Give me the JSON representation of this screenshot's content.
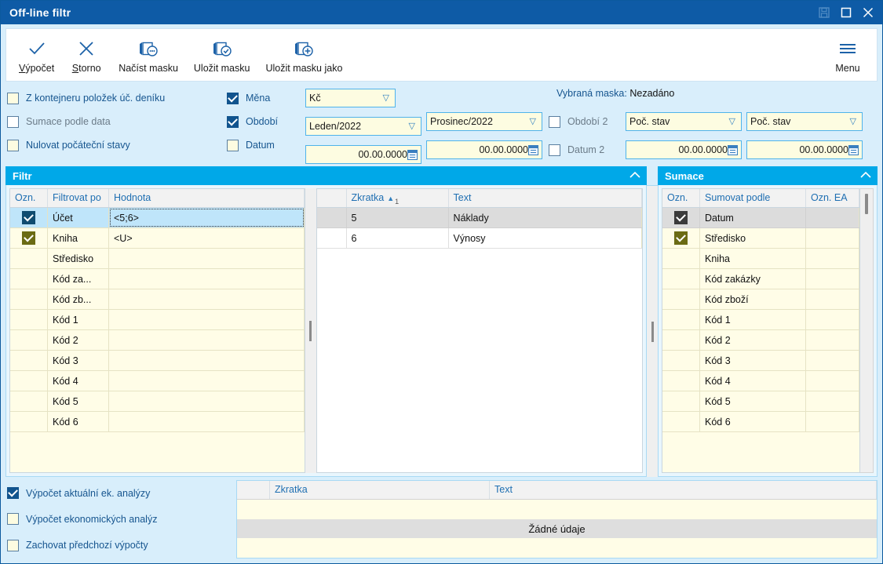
{
  "window": {
    "title": "Off-line filtr",
    "controls": [
      {
        "name": "save-icon",
        "glyph": "save"
      },
      {
        "name": "maximize-icon",
        "glyph": "maximize"
      },
      {
        "name": "close-icon",
        "glyph": "close"
      }
    ]
  },
  "toolbar": {
    "items": [
      {
        "name": "vypocet",
        "label": "Výpočet",
        "accel": "V",
        "icon": "check-icon"
      },
      {
        "name": "storno",
        "label": "Storno",
        "accel": "S",
        "icon": "close-icon"
      },
      {
        "name": "nacist-masku",
        "label": "Načíst masku",
        "icon": "mask-load-icon"
      },
      {
        "name": "ulozit-masku",
        "label": "Uložit masku",
        "icon": "mask-save-icon"
      },
      {
        "name": "ulozit-masku-jako",
        "label": "Uložit masku jako",
        "icon": "mask-saveas-icon"
      }
    ],
    "menu_label": "Menu"
  },
  "options": {
    "left_checks": [
      {
        "label": "Z kontejneru položek úč. deníku",
        "checked": false,
        "style": "cream"
      },
      {
        "label": "Sumace podle data",
        "checked": false,
        "style": "white",
        "dimmed": true
      },
      {
        "label": "Nulovat počáteční stavy",
        "checked": false,
        "style": "cream"
      }
    ],
    "mid_checks": [
      {
        "label": "Měna",
        "checked": true
      },
      {
        "label": "Období",
        "checked": true
      },
      {
        "label": "Datum",
        "checked": false
      }
    ],
    "second_checks": [
      {
        "label": "Období 2",
        "checked": false
      },
      {
        "label": "Datum 2",
        "checked": false
      }
    ],
    "fields": {
      "mena": "Kč",
      "obdobi_from": "Leden/2022",
      "obdobi_to": "Prosinec/2022",
      "datum_from": "00.00.0000",
      "datum_to": "00.00.0000",
      "obdobi2_from": "Poč. stav",
      "obdobi2_to": "Poč. stav",
      "datum2_from": "00.00.0000",
      "datum2_to": "00.00.0000"
    },
    "mask_label": "Vybraná maska:",
    "mask_value": "Nezadáno"
  },
  "filter_panel": {
    "title": "Filtr",
    "collapse_icon": "chevron-up-icon",
    "columns": [
      "Ozn.",
      "Filtrovat po",
      "Hodnota"
    ],
    "rows": [
      {
        "checked": true,
        "check_style": "navy",
        "name": "Účet",
        "value": "<5;6>",
        "selected": true
      },
      {
        "checked": true,
        "check_style": "olive",
        "name": "Kniha",
        "value": "<U>",
        "selected": false
      },
      {
        "checked": false,
        "name": "Středisko",
        "value": "",
        "selected": false
      },
      {
        "checked": false,
        "name": "Kód za...",
        "value": "",
        "selected": false
      },
      {
        "checked": false,
        "name": "Kód zb...",
        "value": "",
        "selected": false
      },
      {
        "checked": false,
        "name": "Kód 1",
        "value": "",
        "selected": false
      },
      {
        "checked": false,
        "name": "Kód 2",
        "value": "",
        "selected": false
      },
      {
        "checked": false,
        "name": "Kód 3",
        "value": "",
        "selected": false
      },
      {
        "checked": false,
        "name": "Kód 4",
        "value": "",
        "selected": false
      },
      {
        "checked": false,
        "name": "Kód 5",
        "value": "",
        "selected": false
      },
      {
        "checked": false,
        "name": "Kód 6",
        "value": "",
        "selected": false
      }
    ]
  },
  "detail_panel": {
    "columns": [
      {
        "label": "Zkratka",
        "sort": "asc",
        "sort_order": "1"
      },
      {
        "label": "Text"
      }
    ],
    "rows": [
      {
        "zkratka": "5",
        "text": "Náklady",
        "selected": true
      },
      {
        "zkratka": "6",
        "text": "Výnosy",
        "selected": false
      }
    ]
  },
  "sumace_panel": {
    "title": "Sumace",
    "collapse_icon": "chevron-up-icon",
    "columns": [
      "Ozn.",
      "Sumovat podle",
      "Ozn. EA"
    ],
    "rows": [
      {
        "checked": true,
        "check_style": "dark",
        "name": "Datum",
        "selected": true
      },
      {
        "checked": true,
        "check_style": "olive",
        "name": "Středisko",
        "selected": false
      },
      {
        "checked": false,
        "name": "Kniha",
        "selected": false
      },
      {
        "checked": false,
        "name": "Kód zakázky",
        "selected": false
      },
      {
        "checked": false,
        "name": "Kód zboží",
        "selected": false
      },
      {
        "checked": false,
        "name": "Kód 1",
        "selected": false
      },
      {
        "checked": false,
        "name": "Kód 2",
        "selected": false
      },
      {
        "checked": false,
        "name": "Kód 3",
        "selected": false
      },
      {
        "checked": false,
        "name": "Kód 4",
        "selected": false
      },
      {
        "checked": false,
        "name": "Kód 5",
        "selected": false
      },
      {
        "checked": false,
        "name": "Kód 6",
        "selected": false
      }
    ]
  },
  "bottom": {
    "checks": [
      {
        "label": "Výpočet aktuální ek. analýzy",
        "checked": true
      },
      {
        "label": "Výpočet ekonomických analýz",
        "checked": false
      },
      {
        "label": "Zachovat předchozí výpočty",
        "checked": false
      }
    ],
    "columns": [
      "Zkratka",
      "Text"
    ],
    "empty_message": "Žádné údaje"
  },
  "colors": {
    "title_bar": "#0e5ba6",
    "panel_header": "#00a8e8",
    "accent_blue": "#16558f",
    "field_bg": "#fdfce1",
    "field_border": "#4fb3ea",
    "page_bg": "#d9eefb",
    "row_selected_blue": "#bfe5fa",
    "row_selected_grey": "#dcdcdc",
    "check_navy": "#0f4c70",
    "check_olive": "#6b6b14",
    "check_dark": "#3b3b3b"
  }
}
